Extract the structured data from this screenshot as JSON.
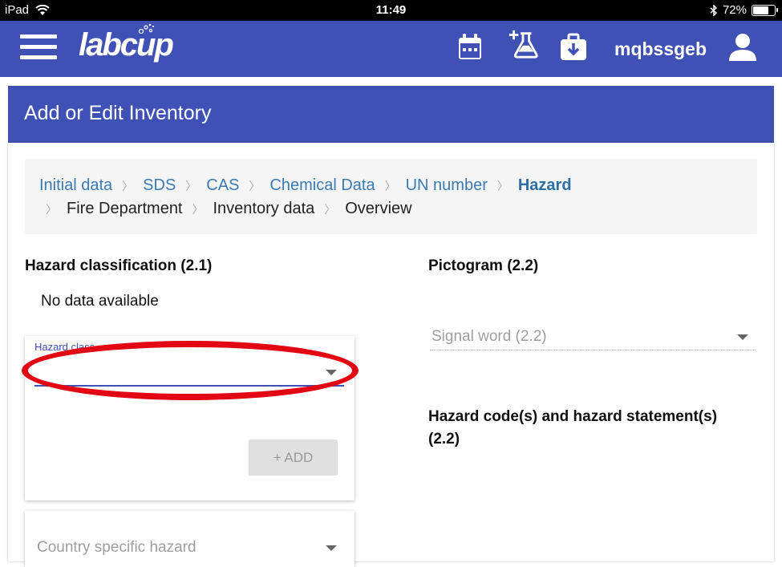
{
  "status_bar": {
    "device": "iPad",
    "time": "11:49",
    "battery": "72%",
    "battery_level": 0.72
  },
  "app_bar": {
    "logo": "labcup",
    "username": "mqbssgeb",
    "icons": [
      "menu-icon",
      "calendar-icon",
      "add-flask-icon",
      "medkit-download-icon",
      "user-icon"
    ],
    "color": "#3f51b5"
  },
  "page": {
    "title": "Add or Edit Inventory"
  },
  "breadcrumb": {
    "items": [
      "Initial data",
      "SDS",
      "CAS",
      "Chemical Data",
      "UN number",
      "Hazard",
      "Fire Department",
      "Inventory data",
      "Overview"
    ],
    "active": "Hazard"
  },
  "hazard_classification": {
    "title": "Hazard classification (2.1)",
    "no_data": "No data available",
    "select_label": "Hazard class",
    "add_label": "+ ADD"
  },
  "country_hazard": {
    "placeholder": "Country specific hazard"
  },
  "pictogram": {
    "title": "Pictogram (2.2)",
    "signal_word_placeholder": "Signal word (2.2)"
  },
  "hazard_codes": {
    "title": "Hazard code(s) and hazard statement(s)",
    "title_line2": "(2.2)"
  }
}
